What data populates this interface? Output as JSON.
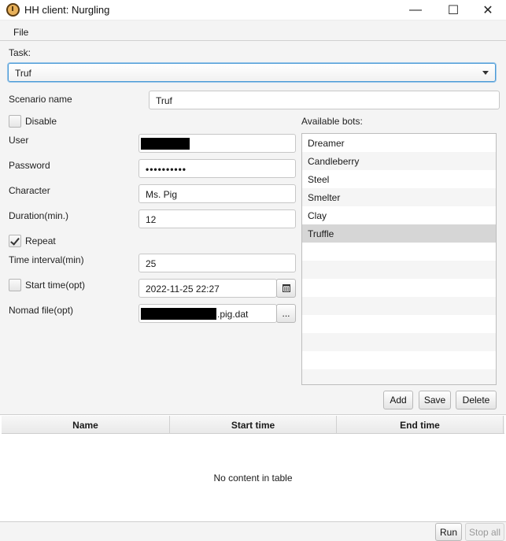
{
  "window": {
    "title": "HH client: Nurgling",
    "minimize_glyph": "—",
    "maximize_glyph": "☐",
    "close_glyph": "✕"
  },
  "menu": {
    "file": "File"
  },
  "task": {
    "label": "Task:",
    "value": "Truf"
  },
  "scenario": {
    "label": "Scenario name",
    "value": "Truf"
  },
  "disable": {
    "label": "Disable",
    "checked": false
  },
  "user": {
    "label": "User"
  },
  "password": {
    "label": "Password",
    "value": "••••••••••"
  },
  "character": {
    "label": "Character",
    "value": "Ms. Pig"
  },
  "duration": {
    "label": "Duration(min.)",
    "value": "12"
  },
  "repeat": {
    "label": "Repeat",
    "checked": true
  },
  "time_interval": {
    "label": "Time interval(min)",
    "value": "25"
  },
  "start_time": {
    "label": "Start time(opt)",
    "checked": false,
    "value": "2022-11-25 22:27",
    "picker_icon": "calendar-icon"
  },
  "nomad": {
    "label": "Nomad file(opt)",
    "value_suffix": ".pig.dat",
    "browse_label": "..."
  },
  "bots": {
    "label": "Available bots:",
    "items": [
      "Dreamer",
      "Candleberry",
      "Steel",
      "Smelter",
      "Clay",
      "Truffle"
    ],
    "selected": "Truffle",
    "add_label": "Add",
    "save_label": "Save",
    "delete_label": "Delete"
  },
  "table": {
    "columns": [
      "Name",
      "Start time",
      "End time"
    ],
    "empty_message": "No content in table"
  },
  "footer": {
    "run_label": "Run",
    "stop_all_label": "Stop all"
  },
  "colors": {
    "focus_border": "#4a9ad6",
    "selected_row": "#d6d6d6"
  }
}
